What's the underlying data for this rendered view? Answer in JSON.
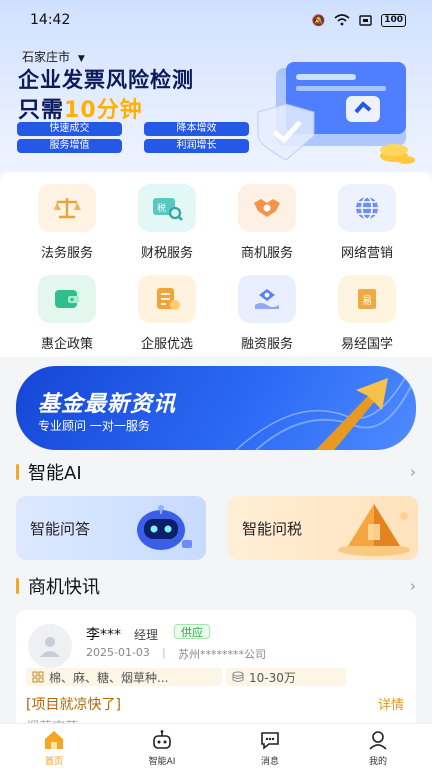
{
  "status_bar": {
    "time": "14:42",
    "battery": "100"
  },
  "hero": {
    "city": "石家庄市",
    "title": "企业发票风险检测",
    "subtitle_prefix": "只需",
    "subtitle_accent": "10分钟",
    "tags": [
      "快速成交",
      "降本增效",
      "服务增值",
      "利润增长"
    ]
  },
  "services": [
    {
      "label": "法务服务",
      "icon": "scale-icon",
      "bg": "#fff4e3"
    },
    {
      "label": "财税服务",
      "icon": "tax-search-icon",
      "bg": "#e3f7f5"
    },
    {
      "label": "商机服务",
      "icon": "handshake-icon",
      "bg": "#fff0e6"
    },
    {
      "label": "网络营销",
      "icon": "globe-icon",
      "bg": "#eef2ff"
    },
    {
      "label": "惠企政策",
      "icon": "wallet-icon",
      "bg": "#e4f7ef"
    },
    {
      "label": "企服优选",
      "icon": "document-icon",
      "bg": "#fff3e0"
    },
    {
      "label": "融资服务",
      "icon": "money-hand-icon",
      "bg": "#e9efff"
    },
    {
      "label": "易经国学",
      "icon": "book-icon",
      "bg": "#fff4e0"
    }
  ],
  "fund_banner": {
    "title": "基金最新资讯",
    "subtitle": "专业顾问 一对一服务"
  },
  "ai_section": {
    "title": "智能AI",
    "cards": [
      {
        "label": "智能问答",
        "icon": "robot-icon"
      },
      {
        "label": "智能问税",
        "icon": "pyramid-icon"
      }
    ]
  },
  "news_section": {
    "title": "商机快讯",
    "item": {
      "name": "李***",
      "role": "经理",
      "badge": "供应",
      "date": "2025-01-03",
      "company": "苏州********公司",
      "products": "棉、麻、糖、烟草种...",
      "price": "10-30万",
      "headline": "[项目就凉快了]",
      "detail": "详情",
      "preview": "烟草农药..."
    }
  },
  "tabbar": [
    {
      "label": "首页",
      "icon": "home-icon",
      "active": true
    },
    {
      "label": "智能AI",
      "icon": "robot-icon",
      "active": false
    },
    {
      "label": "消息",
      "icon": "chat-icon",
      "active": false
    },
    {
      "label": "我的",
      "icon": "user-icon",
      "active": false
    }
  ],
  "colors": {
    "accent": "#f39a12",
    "brand_blue": "#2459e8",
    "section_bar": "#f5a623"
  }
}
